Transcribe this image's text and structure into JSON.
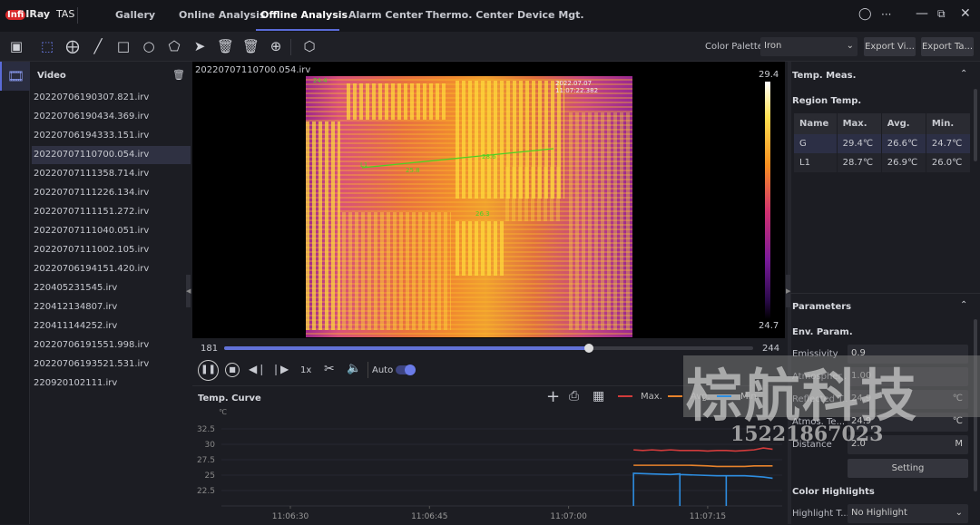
{
  "app": {
    "brand": "IRay",
    "brand_prefix": "Infi",
    "product": "TAS"
  },
  "nav": {
    "items": [
      "Gallery",
      "Online Analysis",
      "Offline Analysis",
      "Alarm Center",
      "Thermo. Center",
      "Device Mgt."
    ],
    "active": "Offline Analysis"
  },
  "window_icons": [
    "user-icon",
    "more-icon",
    "minimize-icon",
    "restore-icon",
    "close-icon"
  ],
  "toolbar": {
    "tools": [
      "image-icon",
      "select-icon",
      "point-icon",
      "line-icon",
      "rectangle-icon",
      "circle-icon",
      "polygon-icon",
      "pointer-icon",
      "delete-icon",
      "delete-all-icon",
      "zoom-icon",
      "3d-icon"
    ],
    "palette_label": "Color Palette",
    "palette_value": "Iron",
    "export_video": "Export Vi...",
    "export_table": "Export Ta..."
  },
  "sidebar": {
    "title": "Video",
    "files": [
      "20220706190307.821.irv",
      "20220706190434.369.irv",
      "20220706194333.151.irv",
      "20220707110700.054.irv",
      "20220707111358.714.irv",
      "20220707111226.134.irv",
      "20220707111151.272.irv",
      "20220707111040.051.irv",
      "20220707111002.105.irv",
      "20220706194151.420.irv",
      "220405231545.irv",
      "220412134807.irv",
      "220411144252.irv",
      "20220706191551.998.irv",
      "20220706193521.531.irv",
      "220920102111.irv"
    ],
    "active_index": 3
  },
  "video": {
    "filename": "20220707110700.054.irv",
    "timestamp": "2022.07.07 11:07:22.382",
    "overlay_labels": {
      "G": "24.4",
      "L1": "L1",
      "low": "25.8",
      "high": "28.6",
      "point": "26.3"
    },
    "colorbar_max": "29.4",
    "colorbar_min": "24.7",
    "frame_start": "181",
    "frame_end": "244",
    "frame_progress": 0.69,
    "speed": "1x",
    "auto_label": "Auto",
    "auto_on": true
  },
  "temp_curve": {
    "title": "Temp. Curve",
    "legend": [
      "Max.",
      "Avg.",
      "Min."
    ]
  },
  "chart_data": {
    "type": "line",
    "ylabel": "℃",
    "yticks": [
      "32.5",
      "30",
      "27.5",
      "25",
      "22.5"
    ],
    "ylim": [
      20,
      33.5
    ],
    "xticks": [
      "11:06:30",
      "11:06:45",
      "11:07:00",
      "11:07:15"
    ],
    "series": [
      {
        "name": "Max.",
        "color": "#d23b3b",
        "points": [
          [
            "11:07:07",
            29.1
          ],
          [
            "11:07:08",
            29.0
          ],
          [
            "11:07:09",
            29.1
          ],
          [
            "11:07:10",
            29.0
          ],
          [
            "11:07:11",
            29.1
          ],
          [
            "11:07:12",
            29.0
          ],
          [
            "11:07:13",
            29.0
          ],
          [
            "11:07:14",
            29.0
          ],
          [
            "11:07:15",
            28.9
          ],
          [
            "11:07:16",
            29.0
          ],
          [
            "11:07:17",
            29.0
          ],
          [
            "11:07:18",
            28.9
          ],
          [
            "11:07:19",
            29.0
          ],
          [
            "11:07:20",
            29.1
          ],
          [
            "11:07:21",
            29.4
          ],
          [
            "11:07:22",
            29.2
          ]
        ]
      },
      {
        "name": "Avg.",
        "color": "#e8832c",
        "points": [
          [
            "11:07:07",
            26.6
          ],
          [
            "11:07:09",
            26.6
          ],
          [
            "11:07:11",
            26.6
          ],
          [
            "11:07:13",
            26.6
          ],
          [
            "11:07:15",
            26.5
          ],
          [
            "11:07:16",
            26.4
          ],
          [
            "11:07:18",
            26.4
          ],
          [
            "11:07:19",
            26.4
          ],
          [
            "11:07:20",
            26.5
          ],
          [
            "11:07:22",
            26.5
          ]
        ]
      },
      {
        "name": "Min.",
        "color": "#2d8de0",
        "points": [
          [
            "11:07:07",
            20
          ],
          [
            "11:07:07",
            25.3
          ],
          [
            "11:07:09",
            25.2
          ],
          [
            "11:07:11",
            25.1
          ],
          [
            "11:07:12",
            25.2
          ],
          [
            "11:07:12",
            20
          ],
          [
            "11:07:12",
            25.1
          ],
          [
            "11:07:14",
            25.0
          ],
          [
            "11:07:16",
            24.9
          ],
          [
            "11:07:17",
            24.9
          ],
          [
            "11:07:17",
            20
          ],
          [
            "11:07:17",
            24.9
          ],
          [
            "11:07:19",
            24.9
          ],
          [
            "11:07:20",
            24.8
          ],
          [
            "11:07:21",
            24.7
          ],
          [
            "11:07:22",
            24.5
          ]
        ]
      }
    ]
  },
  "temp_meas": {
    "title": "Temp. Meas.",
    "region_title": "Region Temp.",
    "columns": [
      "Name",
      "Max.",
      "Avg.",
      "Min."
    ],
    "rows": [
      [
        "G",
        "29.4℃",
        "26.6℃",
        "24.7℃"
      ],
      [
        "L1",
        "28.7℃",
        "26.9℃",
        "26.0℃"
      ]
    ]
  },
  "parameters": {
    "title": "Parameters",
    "env_title": "Env. Param.",
    "fields": [
      {
        "label": "Emissivity",
        "value": "0.9",
        "unit": ""
      },
      {
        "label": "Atmospher...",
        "value": "1.00",
        "unit": ""
      },
      {
        "label": "Reflected T...",
        "value": "24.9",
        "unit": "℃"
      },
      {
        "label": "Atmos. Te...",
        "value": "24.9",
        "unit": "℃"
      },
      {
        "label": "Distance",
        "value": "2.0",
        "unit": "M"
      }
    ],
    "setting_button": "Setting",
    "highlights_title": "Color Highlights",
    "highlight_label": "Highlight T...",
    "highlight_value": "No Highlight"
  },
  "watermark": {
    "text": "棕航科技",
    "phone": "15221867023"
  }
}
